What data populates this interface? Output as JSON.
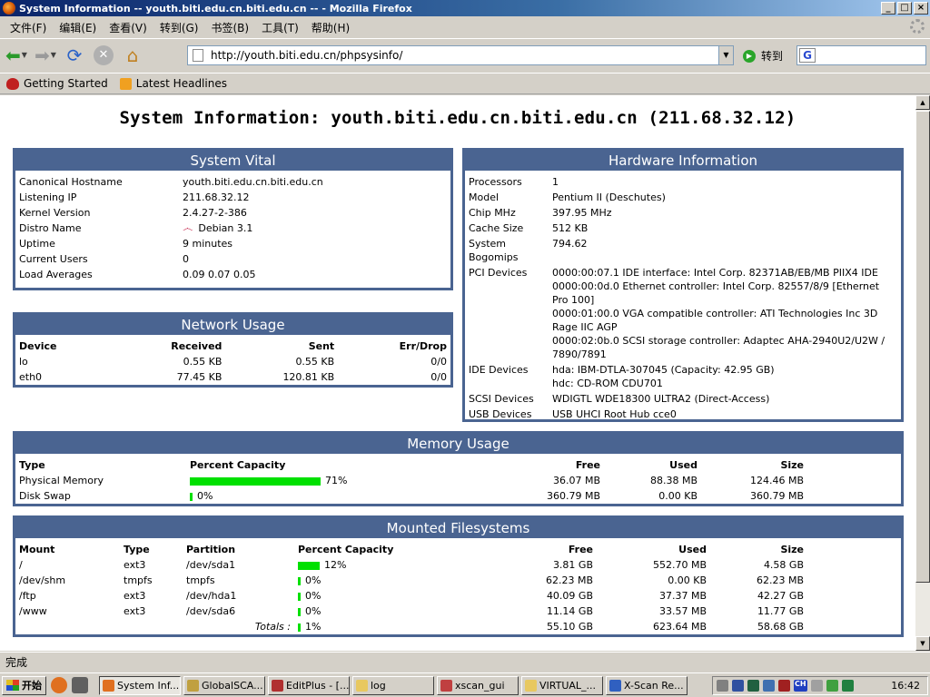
{
  "window": {
    "title": "System Information -- youth.biti.edu.cn.biti.edu.cn -- - Mozilla Firefox",
    "btn_min": "_",
    "btn_max": "□",
    "btn_close": "×"
  },
  "menu": [
    "文件(F)",
    "编辑(E)",
    "查看(V)",
    "转到(G)",
    "书签(B)",
    "工具(T)",
    "帮助(H)"
  ],
  "nav": {
    "url": "http://youth.biti.edu.cn/phpsysinfo/",
    "go_label": "转到",
    "search_value": ""
  },
  "bookmarks": [
    "Getting Started",
    "Latest Headlines"
  ],
  "page": {
    "title": "System Information: youth.biti.edu.cn.biti.edu.cn (211.68.32.12)",
    "vital": {
      "heading": "System Vital",
      "rows": [
        [
          "Canonical Hostname",
          "youth.biti.edu.cn.biti.edu.cn"
        ],
        [
          "Listening IP",
          "211.68.32.12"
        ],
        [
          "Kernel Version",
          "2.4.27-2-386"
        ],
        [
          "Distro Name",
          "Debian 3.1"
        ],
        [
          "Uptime",
          "9 minutes"
        ],
        [
          "Current Users",
          "0"
        ],
        [
          "Load Averages",
          "0.09 0.07 0.05"
        ]
      ]
    },
    "network": {
      "heading": "Network Usage",
      "headers": [
        "Device",
        "Received",
        "Sent",
        "Err/Drop"
      ],
      "rows": [
        [
          "lo",
          "0.55 KB",
          "0.55 KB",
          "0/0"
        ],
        [
          "eth0",
          "77.45 KB",
          "120.81 KB",
          "0/0"
        ]
      ]
    },
    "hardware": {
      "heading": "Hardware Information",
      "rows": [
        [
          "Processors",
          "1"
        ],
        [
          "Model",
          "Pentium II (Deschutes)"
        ],
        [
          "Chip MHz",
          "397.95 MHz"
        ],
        [
          "Cache Size",
          "512 KB"
        ],
        [
          "System Bogomips",
          "794.62"
        ],
        [
          "PCI Devices",
          "0000:00:07.1 IDE interface: Intel Corp. 82371AB/EB/MB PIIX4 IDE\n0000:00:0d.0 Ethernet controller: Intel Corp. 82557/8/9 [Ethernet Pro 100]\n0000:01:00.0 VGA compatible controller: ATI Technologies Inc 3D Rage IIC AGP\n0000:02:0b.0 SCSI storage controller: Adaptec AHA-2940U2/U2W / 7890/7891"
        ],
        [
          "IDE Devices",
          "hda: IBM-DTLA-307045 (Capacity: 42.95 GB)\nhdc: CD-ROM CDU701"
        ],
        [
          "SCSI Devices",
          "WDIGTL WDE18300 ULTRA2 (Direct-Access)"
        ],
        [
          "USB Devices",
          "USB UHCI Root Hub cce0"
        ]
      ]
    },
    "memory": {
      "heading": "Memory Usage",
      "headers": [
        "Type",
        "Percent Capacity",
        "Free",
        "Used",
        "Size"
      ],
      "rows": [
        {
          "type": "Physical Memory",
          "percent": 71,
          "percent_label": "71%",
          "free": "36.07 MB",
          "used": "88.38 MB",
          "size": "124.46 MB"
        },
        {
          "type": "Disk Swap",
          "percent": 0,
          "percent_label": "0%",
          "free": "360.79 MB",
          "used": "0.00 KB",
          "size": "360.79 MB"
        }
      ]
    },
    "filesystems": {
      "heading": "Mounted Filesystems",
      "headers": [
        "Mount",
        "Type",
        "Partition",
        "Percent Capacity",
        "Free",
        "Used",
        "Size"
      ],
      "rows": [
        {
          "mount": "/",
          "type": "ext3",
          "partition": "/dev/sda1",
          "percent": 12,
          "percent_label": "12%",
          "free": "3.81 GB",
          "used": "552.70 MB",
          "size": "4.58 GB"
        },
        {
          "mount": "/dev/shm",
          "type": "tmpfs",
          "partition": "tmpfs",
          "percent": 0,
          "percent_label": "0%",
          "free": "62.23 MB",
          "used": "0.00 KB",
          "size": "62.23 MB"
        },
        {
          "mount": "/ftp",
          "type": "ext3",
          "partition": "/dev/hda1",
          "percent": 0,
          "percent_label": "0%",
          "free": "40.09 GB",
          "used": "37.37 MB",
          "size": "42.27 GB"
        },
        {
          "mount": "/www",
          "type": "ext3",
          "partition": "/dev/sda6",
          "percent": 0,
          "percent_label": "0%",
          "free": "11.14 GB",
          "used": "33.57 MB",
          "size": "11.77 GB"
        }
      ],
      "totals": {
        "label": "Totals :",
        "percent": 1,
        "percent_label": "1%",
        "free": "55.10 GB",
        "used": "623.64 MB",
        "size": "58.68 GB"
      }
    }
  },
  "status": "完成",
  "taskbar": {
    "start": "开始",
    "tasks": [
      "System Inf...",
      "GlobalSCA...",
      "EditPlus - [...",
      "log",
      "xscan_gui",
      "VIRTUAL_...",
      "X-Scan Re..."
    ],
    "tray_lang": "CH",
    "clock": "16:42"
  },
  "colors": {
    "panel_header": "#4a6491",
    "bar_fill": "#00e000"
  }
}
